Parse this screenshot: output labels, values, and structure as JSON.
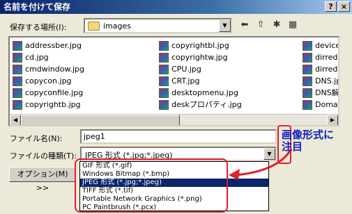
{
  "window": {
    "title": "名前を付けて保存",
    "help_btn": "?",
    "close_btn": "×"
  },
  "save_in": {
    "label": "保存する場所(I):",
    "folder": "images"
  },
  "files": {
    "col1": [
      "addressber.jpg",
      "cd.jpg",
      "cmdwindow.jpg",
      "copycon.jpg",
      "copyconfile.jpg",
      "copyrightb.jpg"
    ],
    "col2": [
      "copyrightbl.jpg",
      "copyrightw.jpg",
      "CPU.jpg",
      "CRT.jpg",
      "desktopmenu.jpg",
      "deskプロパティ.jpg"
    ],
    "col3": [
      "device",
      "dirredi",
      "dirredi",
      "DNS.jp",
      "DNS解",
      "Domai"
    ]
  },
  "filename": {
    "label": "ファイル名(N):",
    "value": "jpeg1"
  },
  "filetype": {
    "label": "ファイルの種類(T):",
    "value": "JPEG 形式 (*.jpg;*.jpeg)",
    "options": [
      "GIF 形式 (*.gif)",
      "Windows Bitmap (*.bmp)",
      "JPEG 形式 (*.jpg;*.jpeg)",
      "TIFF 形式 (*.tif)",
      "Portable Network Graphics (*.png)",
      "PC Paintbrush (*.pcx)"
    ],
    "selected_index": 2
  },
  "options_btn": "オプション(M) >>",
  "annotation": {
    "line1": "画像形式に",
    "line2": "注目",
    "color": "#0a1ec0",
    "highlight_color": "#e0202a"
  }
}
